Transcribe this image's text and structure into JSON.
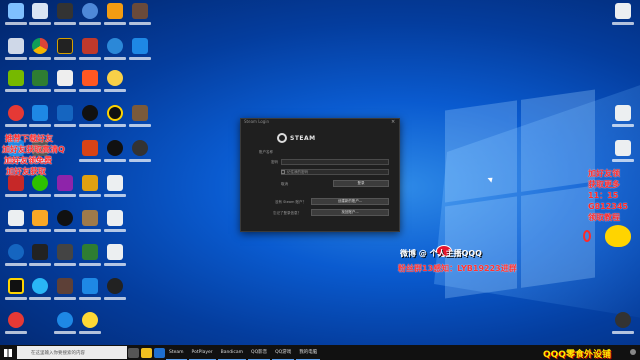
{
  "desktop": {
    "overlay_left": [
      "推荐下载好友",
      "加好友获取高清Q",
      "加好友领免费",
      "加好友获取"
    ],
    "right_notice": [
      "加好友领",
      "获取更多",
      "11：15",
      "G812345",
      "领取教程"
    ],
    "weibo_line": "微博 @ 个人主播QQQ",
    "promo_line": "粉丝群13感知：LYB19223进群",
    "banner": "QQQ零食外设铺"
  },
  "steam_dialog": {
    "window_title": "Steam Login",
    "brand": "STEAM",
    "account_label": "账户名称",
    "password_label": "密码",
    "remember_label": "记住我的密码",
    "login_button": "登录",
    "cancel_button": "取消",
    "no_account_label": "没有 Steam 账户？",
    "create_button": "创建新的账户...",
    "forgot_label": "忘记了登录信息？",
    "recover_button": "找回账户..."
  },
  "taskbar": {
    "search_placeholder": "在这里输入你要搜索的内容",
    "apps": [
      "Steam",
      "PotPlayer",
      "Bandicam",
      "QQ影音",
      "QQ游戏",
      "我的电脑"
    ]
  }
}
